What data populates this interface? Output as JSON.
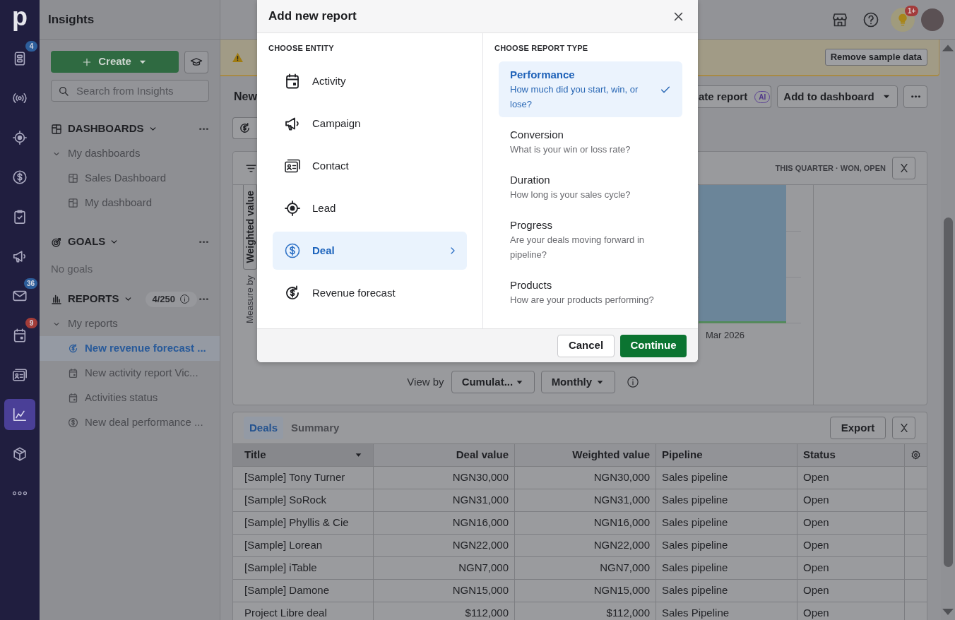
{
  "nav_rail": {
    "logo": "p",
    "items": [
      {
        "selected": false,
        "badge": {
          "text": "4",
          "color": "#2d5e9b"
        }
      },
      {
        "selected": false
      },
      {
        "selected": false
      },
      {
        "selected": false
      },
      {
        "selected": false
      },
      {
        "selected": false
      },
      {
        "selected": false,
        "badge": {
          "text": "36",
          "color": "#2d5e9b"
        }
      },
      {
        "selected": false,
        "badge": {
          "text": "9",
          "color": "#a23c39"
        }
      },
      {
        "selected": false
      },
      {
        "selected": true
      },
      {
        "selected": false
      },
      {
        "selected": false
      }
    ]
  },
  "sidebar": {
    "title": "Insights",
    "create_button": "Create",
    "search": {
      "placeholder": "Search from Insights"
    },
    "sections": [
      {
        "kind": "dashboards",
        "title": "DASHBOARDS",
        "folder": {
          "label": "My dashboards",
          "expanded": true,
          "children": [
            {
              "label": "Sales Dashboard",
              "kind": "dashboard",
              "selected": false
            },
            {
              "label": "My dashboard",
              "kind": "dashboard",
              "selected": false
            }
          ]
        }
      },
      {
        "kind": "goals",
        "title": "GOALS",
        "empty_text": "No goals"
      },
      {
        "kind": "reports",
        "title": "REPORTS",
        "count": "4/250",
        "folder": {
          "label": "My reports",
          "expanded": true,
          "children": [
            {
              "label": "New revenue forecast ...",
              "kind": "revenue",
              "selected": true
            },
            {
              "label": "New activity report Vic...",
              "kind": "activity",
              "selected": false
            },
            {
              "label": "Activities status",
              "kind": "activity",
              "selected": false
            },
            {
              "label": "New deal performance ...",
              "kind": "deal",
              "selected": false
            }
          ]
        }
      }
    ]
  },
  "top_bar": {
    "notification_badge": "1+"
  },
  "banner": {
    "button": "Remove sample data"
  },
  "report": {
    "title": "New",
    "actions": [
      {
        "kind": "ai",
        "label": "ate report",
        "badge": "AI"
      },
      {
        "kind": "menu",
        "label": "Add to dashboard"
      }
    ]
  },
  "chart_card": {
    "filters": "THIS QUARTER · WON, OPEN",
    "measure_select": "Weighted value",
    "measure_label": "Measure by",
    "x_labels": [
      "Mar 2026"
    ],
    "view_by": {
      "label": "View by",
      "selects": [
        "Cumulat...",
        "Monthly"
      ]
    }
  },
  "table_card": {
    "tabs": [
      {
        "label": "Deals",
        "selected": true
      },
      {
        "label": "Summary",
        "selected": false
      }
    ],
    "export_button": "Export",
    "columns": [
      {
        "label": "Title",
        "kind": "text",
        "sorted": true
      },
      {
        "label": "Deal value",
        "kind": "number",
        "sorted": false
      },
      {
        "label": "Weighted value",
        "kind": "number",
        "sorted": false
      },
      {
        "label": "Pipeline",
        "kind": "text",
        "sorted": false
      },
      {
        "label": "Status",
        "kind": "text",
        "sorted": false
      }
    ],
    "rows": [
      [
        "[Sample] Tony Turner",
        "NGN30,000",
        "NGN30,000",
        "Sales pipeline",
        "Open"
      ],
      [
        "[Sample] SoRock",
        "NGN31,000",
        "NGN31,000",
        "Sales pipeline",
        "Open"
      ],
      [
        "[Sample] Phyllis & Cie",
        "NGN16,000",
        "NGN16,000",
        "Sales pipeline",
        "Open"
      ],
      [
        "[Sample] Lorean",
        "NGN22,000",
        "NGN22,000",
        "Sales pipeline",
        "Open"
      ],
      [
        "[Sample] iTable",
        "NGN7,000",
        "NGN7,000",
        "Sales pipeline",
        "Open"
      ],
      [
        "[Sample] Damone",
        "NGN15,000",
        "NGN15,000",
        "Sales pipeline",
        "Open"
      ],
      [
        "Project Libre deal",
        "$112,000",
        "$112,000",
        "Sales Pipeline",
        "Open"
      ]
    ]
  },
  "dialog": {
    "title": "Add new report",
    "entity_heading": "CHOOSE ENTITY",
    "entities": [
      {
        "kind": "activity",
        "label": "Activity",
        "selected": false
      },
      {
        "kind": "campaign",
        "label": "Campaign",
        "selected": false
      },
      {
        "kind": "contact",
        "label": "Contact",
        "selected": false
      },
      {
        "kind": "lead",
        "label": "Lead",
        "selected": false
      },
      {
        "kind": "deal",
        "label": "Deal",
        "selected": true
      },
      {
        "kind": "revenue",
        "label": "Revenue forecast",
        "selected": false
      }
    ],
    "type_heading": "CHOOSE REPORT TYPE",
    "report_types": [
      {
        "title": "Performance",
        "description": "How much did you start, win, or lose?",
        "selected": true
      },
      {
        "title": "Conversion",
        "description": "What is your win or loss rate?",
        "selected": false
      },
      {
        "title": "Duration",
        "description": "How long is your sales cycle?",
        "selected": false
      },
      {
        "title": "Progress",
        "description": "Are your deals moving forward in pipeline?",
        "selected": false
      },
      {
        "title": "Products",
        "description": "How are your products performing?",
        "selected": false
      }
    ],
    "buttons": [
      {
        "kind": "secondary",
        "label": "Cancel"
      },
      {
        "kind": "primary",
        "label": "Continue"
      }
    ]
  }
}
